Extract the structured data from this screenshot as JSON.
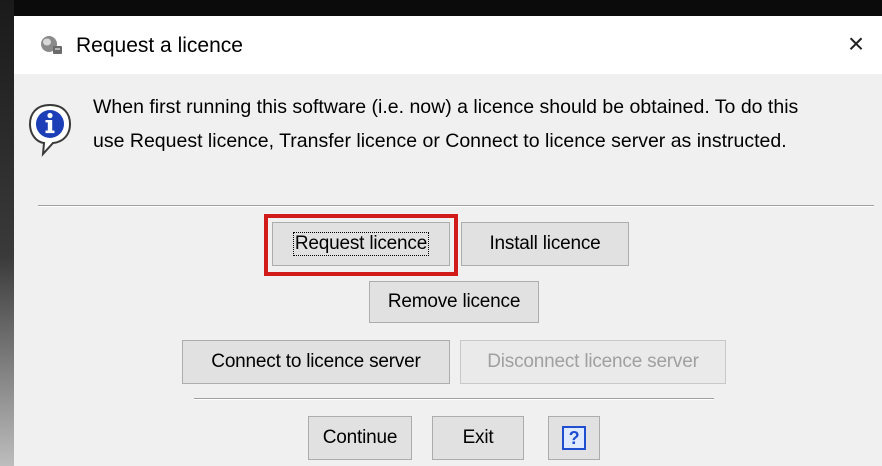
{
  "window": {
    "title": "Request a licence",
    "close_glyph": "×",
    "app_icon": "app-icon",
    "info_icon": "information-icon",
    "message_lines": [
      "When first running this software (i.e. now) a licence should be obtained. To do this",
      "use Request licence, Transfer licence or Connect to licence server as instructed."
    ]
  },
  "buttons": {
    "request_licence": "Request licence",
    "install_licence": "Install licence",
    "remove_licence": "Remove licence",
    "connect_server": "Connect to licence server",
    "disconnect_server": "Disconnect licence server",
    "continue": "Continue",
    "exit": "Exit",
    "help": "?"
  },
  "colors": {
    "highlight": "#d11a1a",
    "dialog_background": "#f0f0f0",
    "help_icon": "#1f4fd0"
  }
}
